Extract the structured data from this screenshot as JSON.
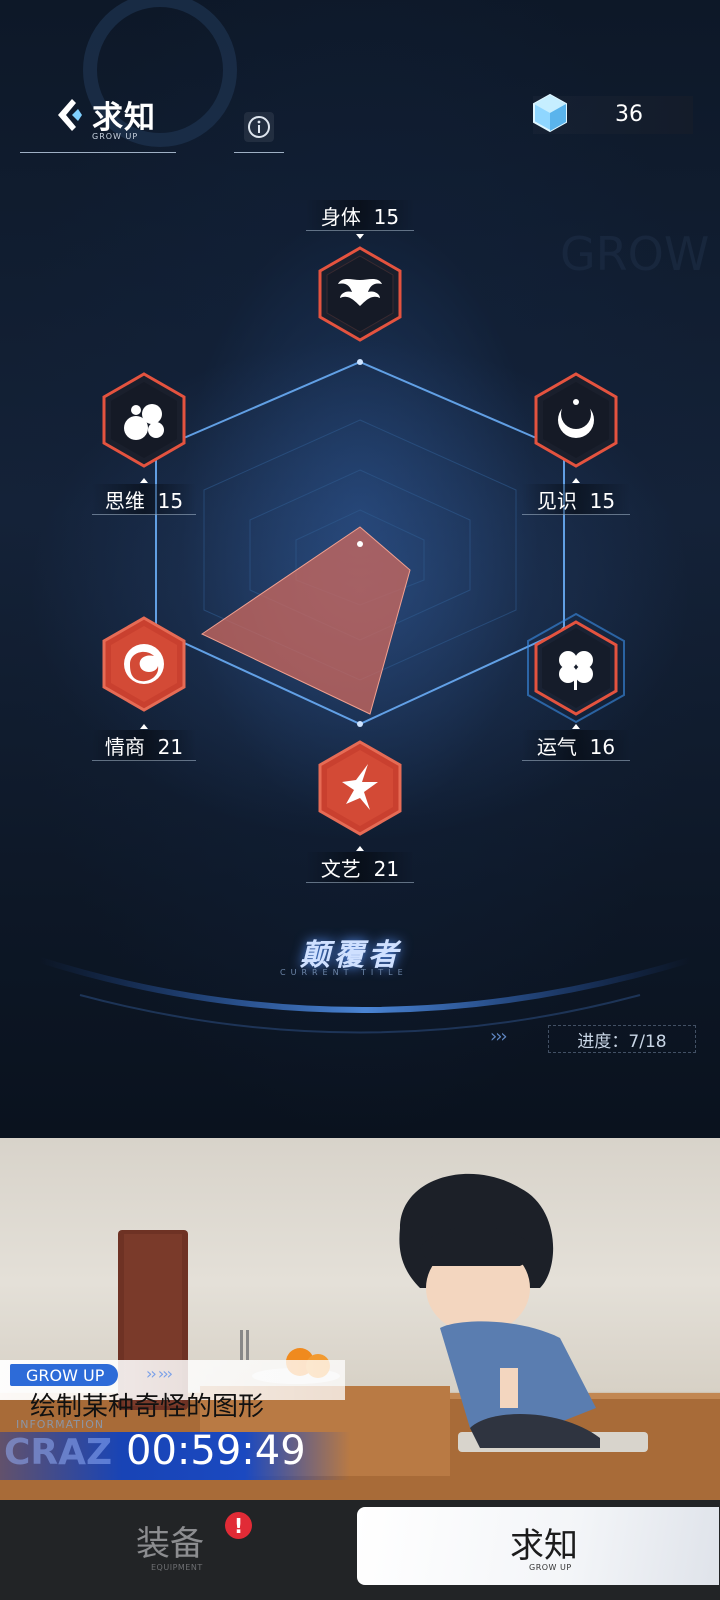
{
  "header": {
    "title": "求知",
    "subtitle": "GROW UP"
  },
  "currency": {
    "value": "36",
    "icon": "crystal-gem-icon"
  },
  "stats": [
    {
      "id": "body",
      "label": "身体  15",
      "value": 15,
      "icon": "phoenix-icon",
      "highlight": false
    },
    {
      "id": "insight",
      "label": "见识  15",
      "value": 15,
      "icon": "crescent-moon-icon",
      "highlight": false
    },
    {
      "id": "luck",
      "label": "运气  16",
      "value": 16,
      "icon": "clover-icon",
      "highlight": true
    },
    {
      "id": "art",
      "label": "文艺  21",
      "value": 21,
      "icon": "star-icon",
      "highlight": false
    },
    {
      "id": "eq",
      "label": "情商  21",
      "value": 21,
      "icon": "swirl-icon",
      "highlight": false
    },
    {
      "id": "thinking",
      "label": "思维  15",
      "value": 15,
      "icon": "cloud-icon",
      "highlight": false
    }
  ],
  "current_title": {
    "text": "颠覆者",
    "subtitle": "CURRENT TITLE"
  },
  "progress": {
    "label": "进度：7/18",
    "current": 7,
    "total": 18
  },
  "activity": {
    "tag": "GROW UP",
    "task": "绘制某种奇怪的图形",
    "info_label": "INFORMATION",
    "ghost_text": "CRAZ",
    "timer": "00:59:49"
  },
  "bottom_nav": {
    "equipment": {
      "label": "装备",
      "sub": "EQUIPMENT",
      "alert": "!"
    },
    "grow": {
      "label": "求知",
      "sub": "GROW UP"
    }
  },
  "colors": {
    "accent_red": "#e4533f",
    "accent_blue": "#4d9dff",
    "alert": "#e12b36"
  }
}
